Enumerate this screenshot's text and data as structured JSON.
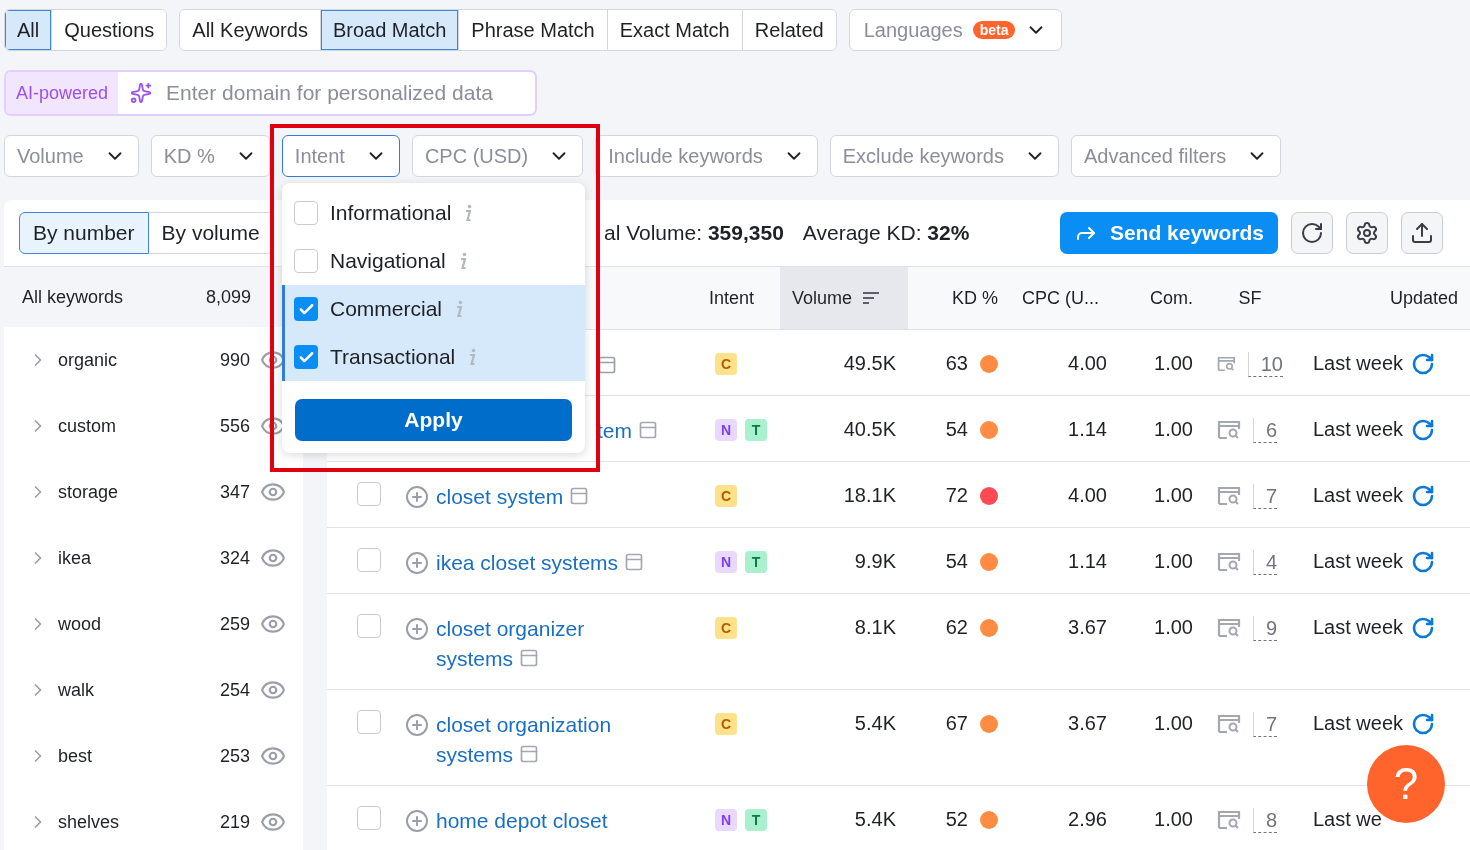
{
  "tab_groups": [
    {
      "tabs": [
        {
          "label": "All",
          "selected": true
        },
        {
          "label": "Questions",
          "selected": false
        }
      ]
    },
    {
      "tabs": [
        {
          "label": "All Keywords",
          "selected": false
        },
        {
          "label": "Broad Match",
          "selected": true
        },
        {
          "label": "Phrase Match",
          "selected": false
        },
        {
          "label": "Exact Match",
          "selected": false
        },
        {
          "label": "Related",
          "selected": false
        }
      ]
    }
  ],
  "languages": {
    "label": "Languages",
    "badge": "beta"
  },
  "ai_search": {
    "label": "AI-powered",
    "placeholder": "Enter domain for personalized data"
  },
  "filters": [
    {
      "label": "Volume",
      "active": false
    },
    {
      "label": "KD %",
      "active": false
    },
    {
      "label": "Intent",
      "active": true
    },
    {
      "label": "CPC (USD)",
      "active": false
    },
    {
      "label": "Include keywords",
      "active": false
    },
    {
      "label": "Exclude keywords",
      "active": false
    },
    {
      "label": "Advanced filters",
      "active": false
    }
  ],
  "view_toggle": [
    {
      "label": "By number",
      "selected": true
    },
    {
      "label": "By volume",
      "selected": false
    }
  ],
  "stats": [
    {
      "label": "al Volume:",
      "value": "359,350"
    },
    {
      "label": "Average KD:",
      "value": "32%"
    }
  ],
  "send_button": "Send keywords",
  "sidebar": {
    "header": {
      "name": "All keywords",
      "count": "8,099"
    },
    "groups": [
      {
        "name": "organic",
        "count": "990"
      },
      {
        "name": "custom",
        "count": "556"
      },
      {
        "name": "storage",
        "count": "347"
      },
      {
        "name": "ikea",
        "count": "324"
      },
      {
        "name": "wood",
        "count": "259"
      },
      {
        "name": "walk",
        "count": "254"
      },
      {
        "name": "best",
        "count": "253"
      },
      {
        "name": "shelves",
        "count": "219"
      }
    ]
  },
  "table": {
    "columns": [
      "Intent",
      "Volume",
      "KD %",
      "CPC (U...",
      "Com.",
      "SF",
      "Updated"
    ],
    "rows": [
      {
        "kind": "covered",
        "intents": [
          {
            "label": "C",
            "kind": "commercial"
          }
        ],
        "volume": "49.5K",
        "kd": "63",
        "color": "#ff8c42",
        "cpc": "4.00",
        "com": "1.00",
        "sf": "10",
        "updated": "Last week"
      },
      {
        "kind": "covered",
        "keyword": "tem",
        "intents": [
          {
            "label": "N",
            "kind": "navigational"
          },
          {
            "label": "T",
            "kind": "transactional"
          }
        ],
        "volume": "40.5K",
        "kd": "54",
        "color": "#ff8c42",
        "cpc": "1.14",
        "com": "1.00",
        "sf": "6",
        "updated": "Last week"
      },
      {
        "kind": "normal",
        "checked": false,
        "keyword": "closet system",
        "intents": [
          {
            "label": "C",
            "kind": "commercial"
          }
        ],
        "volume": "18.1K",
        "kd": "72",
        "color": "#ff4953",
        "cpc": "4.00",
        "com": "1.00",
        "sf": "7",
        "updated": "Last week"
      },
      {
        "kind": "normal",
        "checked": false,
        "keyword": "ikea closet systems",
        "intents": [
          {
            "label": "N",
            "kind": "navigational"
          },
          {
            "label": "T",
            "kind": "transactional"
          }
        ],
        "volume": "9.9K",
        "kd": "54",
        "color": "#ff8c42",
        "cpc": "1.14",
        "com": "1.00",
        "sf": "4",
        "updated": "Last week"
      },
      {
        "kind": "normal",
        "checked": false,
        "keyword": "closet organizer systems",
        "intents": [
          {
            "label": "C",
            "kind": "commercial"
          }
        ],
        "volume": "8.1K",
        "kd": "62",
        "color": "#ff8c42",
        "cpc": "3.67",
        "com": "1.00",
        "sf": "9",
        "updated": "Last week"
      },
      {
        "kind": "normal",
        "checked": false,
        "keyword": "closet organization systems",
        "intents": [
          {
            "label": "C",
            "kind": "commercial"
          }
        ],
        "volume": "5.4K",
        "kd": "67",
        "color": "#ff8c42",
        "cpc": "3.67",
        "com": "1.00",
        "sf": "7",
        "updated": "Last week"
      },
      {
        "kind": "cut",
        "checked": false,
        "keyword": "home depot closet",
        "intents": [
          {
            "label": "N",
            "kind": "navigational"
          },
          {
            "label": "T",
            "kind": "transactional"
          }
        ],
        "volume": "5.4K",
        "kd": "52",
        "color": "#ff8c42",
        "cpc": "2.96",
        "com": "1.00",
        "sf": "8",
        "updated": "Last we"
      }
    ]
  },
  "intent_dropdown": {
    "options": [
      {
        "label": "Informational",
        "checked": false
      },
      {
        "label": "Navigational",
        "checked": false
      },
      {
        "label": "Commercial",
        "checked": true
      },
      {
        "label": "Transactional",
        "checked": true
      }
    ],
    "apply": "Apply"
  },
  "help_button": "?"
}
